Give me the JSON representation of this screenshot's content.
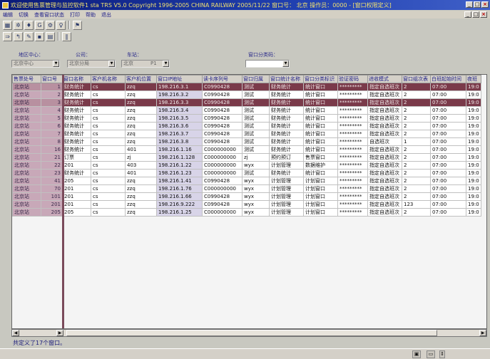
{
  "window": {
    "title": "欢迎使用售票管理与监控软件1 sta TRS V5.0 Copyright 1996-2005 CHINA RAILWAY  2005/11/22  窗口号：  北京  操作员：0000 - [窗口权限定义]"
  },
  "menu": {
    "items": [
      "编辑",
      "切换",
      "查看窗口状态",
      "打印",
      "帮助",
      "退出"
    ]
  },
  "filters": {
    "region_center_label": "地区中心：",
    "region_center_value": "北京中心",
    "company_label": "公司：",
    "company_value": "北京分局",
    "station_label": "车站：",
    "station_value": "北京",
    "station_code": "P1",
    "window_type_label": "窗口分类码：",
    "window_type_value": ""
  },
  "table": {
    "columns": [
      "售票处号",
      "窗口号",
      "窗口名称",
      "客户机名称",
      "客户机位置",
      "窗口IP地址",
      "读卡序列号",
      "窗口归属",
      "窗口统计名称",
      "窗口分类标识",
      "验证密码",
      "进收模式",
      "窗口组次表",
      "白班起始时间",
      "夜班"
    ],
    "rows": [
      [
        "北京站",
        "1",
        "财务统计",
        "cs",
        "zzq",
        "198.216.3.1",
        "C0990428",
        "测试",
        "财务统计",
        "统计窗口",
        "*********",
        "指定自选班次",
        "2",
        "07:00",
        "19:0"
      ],
      [
        "北京站",
        "2",
        "财务统计",
        "cs",
        "zzq",
        "198.216.3.2",
        "C0990428",
        "测试",
        "财务统计",
        "统计窗口",
        "*********",
        "指定自选班次",
        "2",
        "07:00",
        "19:0"
      ],
      [
        "北京站",
        "3",
        "财务统计",
        "cs",
        "zzq",
        "198.216.3.3",
        "C0990428",
        "测试",
        "财务统计",
        "统计窗口",
        "*********",
        "指定自选班次",
        "2",
        "07:00",
        "19:0"
      ],
      [
        "北京站",
        "4",
        "财务统计",
        "cs",
        "zzq",
        "198.216.3.4",
        "C0990428",
        "测试",
        "财务统计",
        "统计窗口",
        "*********",
        "指定自选班次",
        "2",
        "07:00",
        "19:0"
      ],
      [
        "北京站",
        "5",
        "财务统计",
        "cs",
        "zzq",
        "198.216.3.5",
        "C0990428",
        "测试",
        "财务统计",
        "统计窗口",
        "*********",
        "指定自选班次",
        "2",
        "07:00",
        "19:0"
      ],
      [
        "北京站",
        "6",
        "财务统计",
        "cs",
        "zzq",
        "198.216.3.6",
        "C0990428",
        "测试",
        "财务统计",
        "统计窗口",
        "*********",
        "指定自选班次",
        "2",
        "07:00",
        "19:0"
      ],
      [
        "北京站",
        "7",
        "财务统计",
        "cs",
        "zzq",
        "198.216.3.7",
        "C0990428",
        "测试",
        "财务统计",
        "统计窗口",
        "*********",
        "指定自选班次",
        "2",
        "07:00",
        "19:0"
      ],
      [
        "北京站",
        "8",
        "财务统计",
        "cs",
        "zzq",
        "198.216.3.8",
        "C0990428",
        "测试",
        "财务统计",
        "统计窗口",
        "*********",
        "自选班次",
        "1",
        "07:00",
        "19:0"
      ],
      [
        "北京站",
        "16",
        "财务统计",
        "cs",
        "401",
        "198.216.1.16",
        "C000000000",
        "测试",
        "财务统计",
        "统计窗口",
        "*********",
        "指定自选班次",
        "2",
        "07:00",
        "19:0"
      ],
      [
        "北京站",
        "21",
        "订票",
        "cs",
        "zj",
        "198.216.1.128",
        "C000000000",
        "zj",
        "预约预订",
        "售票窗口",
        "*********",
        "指定自选班次",
        "2",
        "07:00",
        "19:0"
      ],
      [
        "北京站",
        "22",
        "201",
        "cs",
        "403",
        "198.216.1.22",
        "C000000000",
        "wyx",
        "计划管理",
        "数据维护",
        "*********",
        "指定自选班次",
        "2",
        "07:00",
        "19:0"
      ],
      [
        "北京站",
        "23",
        "财务统计",
        "cs",
        "401",
        "198.216.1.23",
        "C000000000",
        "测试",
        "财务统计",
        "统计窗口",
        "*********",
        "指定自选班次",
        "2",
        "07:00",
        "19:0"
      ],
      [
        "北京站",
        "41",
        "205",
        "cs",
        "zzq",
        "198.216.1.41",
        "C0990428",
        "wyx",
        "计划管理",
        "计划窗口",
        "*********",
        "指定自选班次",
        "2",
        "07:00",
        "19:0"
      ],
      [
        "北京站",
        "70",
        "201",
        "cs",
        "zzq",
        "198.216.1.76",
        "C000000000",
        "wyx",
        "计划管理",
        "计划窗口",
        "*********",
        "指定自选班次",
        "2",
        "07:00",
        "19:0"
      ],
      [
        "北京站",
        "101",
        "201",
        "cs",
        "zzq",
        "198.216.1.66",
        "C0990428",
        "wyx",
        "计划管理",
        "计划窗口",
        "*********",
        "指定自选班次",
        "2",
        "07:00",
        "19:0"
      ],
      [
        "北京站",
        "201",
        "201",
        "cs",
        "zzq",
        "198.216.9.222",
        "C0990428",
        "wyx",
        "计划管理",
        "计划窗口",
        "*********",
        "指定自选班次",
        "123",
        "07:00",
        "19:0"
      ],
      [
        "北京站",
        "205",
        "205",
        "cs",
        "zzq",
        "198.216.1.25",
        "C000000000",
        "wyx",
        "计划管理",
        "计划窗口",
        "*********",
        "指定自选班次",
        "2",
        "07:00",
        "19:0"
      ]
    ],
    "selected_rows": [
      0,
      2
    ]
  },
  "status": {
    "message": "共定义了17个窗口。"
  },
  "colors": {
    "title_bar": "#1a2a90",
    "fixed_column": "#c8a8b8",
    "selected_row": "#7a3a4a"
  },
  "icons": {
    "toolbar_row1": [
      "grid-icon",
      "stamp-icon",
      "pin-icon",
      "text-icon",
      "gear-icon",
      "person-icon",
      "flag-icon"
    ],
    "toolbar_row2": [
      "train-icon",
      "arrow-icon",
      "pencil-icon",
      "disk-icon",
      "table-icon",
      "columns-icon"
    ]
  }
}
